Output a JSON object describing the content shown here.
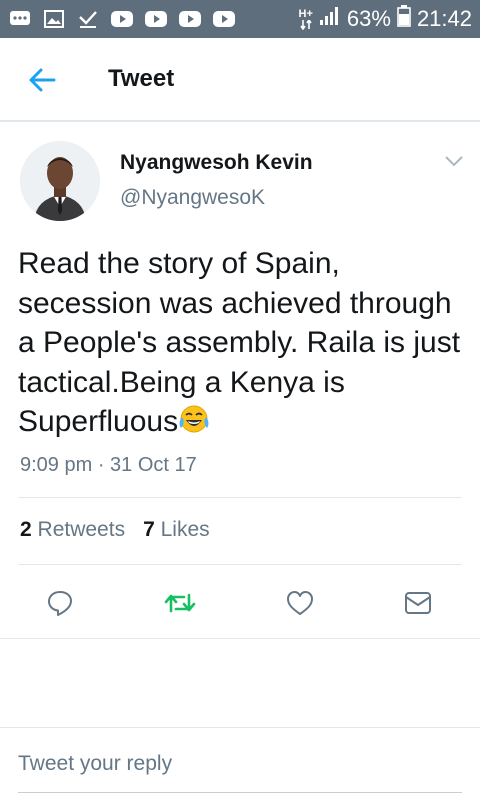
{
  "status_bar": {
    "network": "H+",
    "battery": "63%",
    "time": "21:42"
  },
  "header": {
    "title": "Tweet"
  },
  "tweet": {
    "author_name": "Nyangwesoh Kevin",
    "author_handle": "@NyangwesoK",
    "text": "Read the story of Spain, secession was achieved through a People's assembly. Raila is just tactical.Being a Kenya is Superfluous",
    "emoji": "face-with-tears-of-joy",
    "timestamp": "9:09 pm · 31 Oct 17",
    "retweet_count": "2",
    "retweet_label": "Retweets",
    "like_count": "7",
    "like_label": "Likes"
  },
  "reply": {
    "placeholder": "Tweet your reply"
  },
  "colors": {
    "status_bar_bg": "#5f6e7c",
    "twitter_blue": "#1da1f2",
    "retweet_green": "#17bf63",
    "secondary_text": "#657786",
    "divider": "#e1e8ed"
  }
}
